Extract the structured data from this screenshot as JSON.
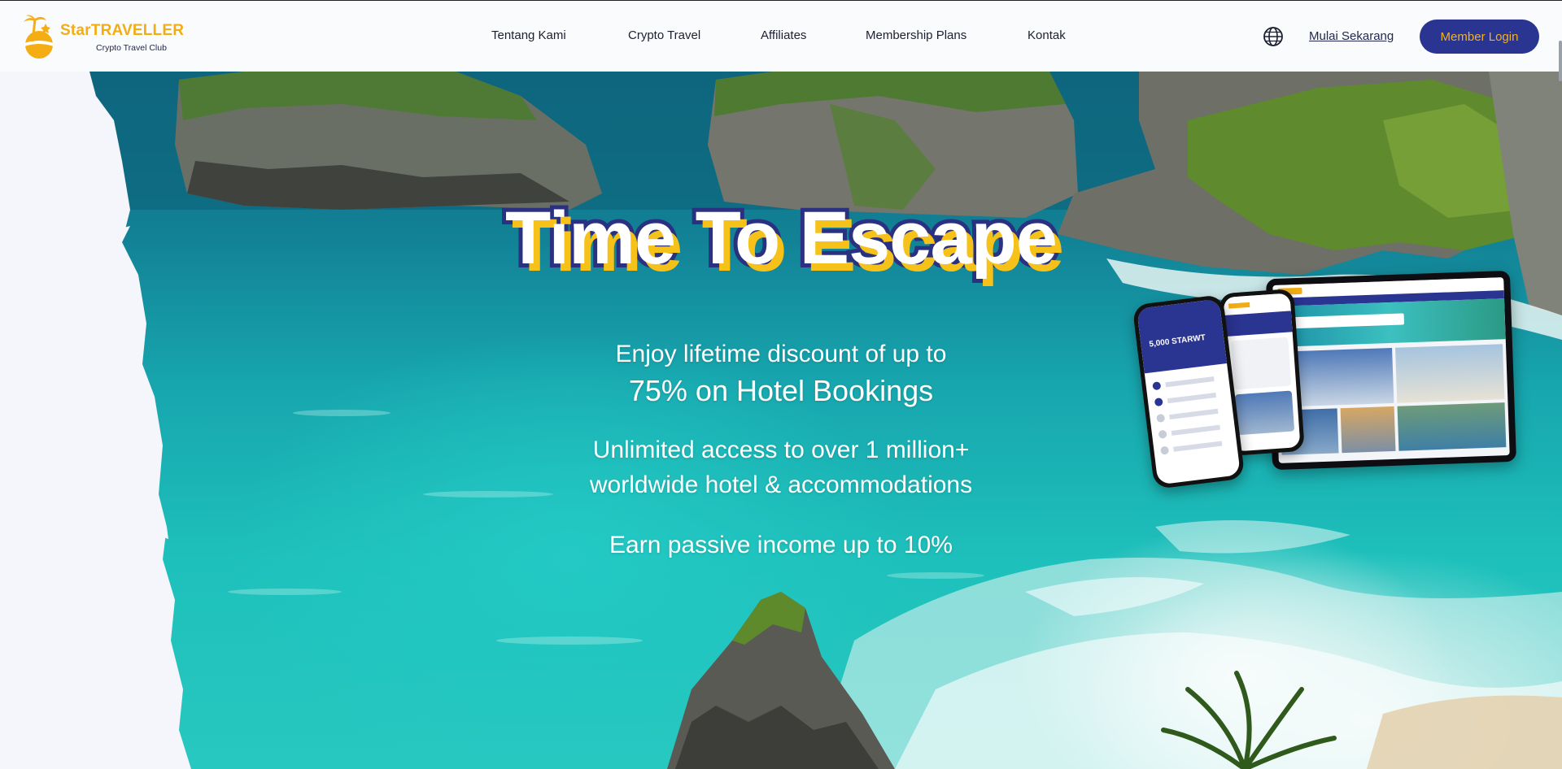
{
  "brand": {
    "name": "StarTRAVELLER",
    "tagline": "Crypto Travel Club",
    "primary_color": "#2a3491",
    "accent_color": "#f2ad14"
  },
  "nav": {
    "items": [
      {
        "label": "Tentang Kami"
      },
      {
        "label": "Crypto Travel"
      },
      {
        "label": "Affiliates"
      },
      {
        "label": "Membership Plans"
      },
      {
        "label": "Kontak"
      }
    ]
  },
  "header_actions": {
    "language_icon": "globe-icon",
    "get_started_label": "Mulai Sekarang",
    "login_label": "Member Login"
  },
  "hero": {
    "headline": "Time To Escape",
    "line1": "Enjoy lifetime discount of up to",
    "line2": "75% on Hotel Bookings",
    "line3": "Unlimited access to over 1 million+",
    "line4": "worldwide hotel & accommodations",
    "line5": "Earn passive income up to 10%"
  },
  "devices_mockup": {
    "phone_balance": "5,000 STARWT"
  }
}
